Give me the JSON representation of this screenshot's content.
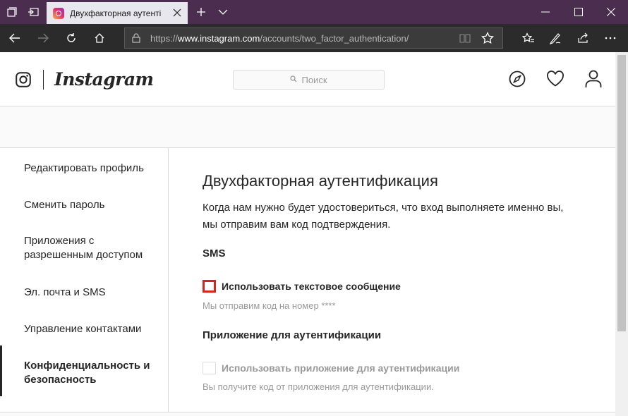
{
  "browser": {
    "tab_title": "Двухфакторная аутентi",
    "url_prefix": "https://",
    "url_host": "www.instagram.com",
    "url_path": "/accounts/two_factor_authentication/",
    "titlebar_color": "#4a2d4f",
    "icons": [
      "tab-manager-icon",
      "set-aside-tabs-icon",
      "close-icon",
      "new-tab-icon",
      "chevron-down-icon",
      "minimize-icon",
      "maximize-icon",
      "back-icon",
      "forward-icon",
      "refresh-icon",
      "home-icon",
      "lock-icon",
      "reading-view-icon",
      "star-icon",
      "favorites-icon",
      "notes-icon",
      "share-icon"
    ]
  },
  "header": {
    "brand": "Instagram",
    "search_placeholder": "Поиск",
    "icons": [
      "explore-icon",
      "heart-icon",
      "profile-icon"
    ]
  },
  "sidebar": {
    "items": [
      {
        "label": "Редактировать профиль"
      },
      {
        "label": "Сменить пароль"
      },
      {
        "label": "Приложения с разрешенным доступом"
      },
      {
        "label": "Эл. почта и SMS"
      },
      {
        "label": "Управление контактами"
      },
      {
        "label": "Конфиденциальность и безопасность",
        "active": true
      }
    ]
  },
  "main": {
    "title": "Двухфакторная аутентификация",
    "description": "Когда нам нужно будет удостовериться, что вход выполняете именно вы, мы отправим вам код подтверждения.",
    "sms": {
      "section_title": "SMS",
      "checkbox_label": "Использовать текстовое сообщение",
      "checked": false,
      "hint": "Мы отправим код на номер ****"
    },
    "app": {
      "section_title": "Приложение для аутентификации",
      "checkbox_label": "Использовать приложение для аутентификации",
      "checked": false,
      "disabled": true,
      "hint": "Вы получите код от приложения для аутентификации."
    }
  },
  "colors": {
    "highlight_red": "#d9231d",
    "text": "#262626",
    "muted": "#999999"
  }
}
